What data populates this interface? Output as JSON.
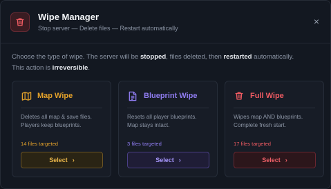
{
  "header": {
    "title": "Wipe Manager",
    "subtitle": "Stop server — Delete files — Restart automatically",
    "close_label": "×"
  },
  "intro": {
    "part1": "Choose the type of wipe. The server will be ",
    "stopped": "stopped",
    "part2": ", files deleted, then ",
    "restarted": "restarted",
    "part3": " automatically.",
    "part4": "This action is ",
    "irreversible": "irreversible",
    "part5": "."
  },
  "cards": [
    {
      "title": "Map Wipe",
      "icon": "map-icon",
      "desc_line1": "Deletes all map & save files.",
      "desc_line2": "Players keep blueprints.",
      "count": "14 files targeted",
      "select_label": "Select",
      "color": "#e3a12a"
    },
    {
      "title": "Blueprint Wipe",
      "icon": "document-icon",
      "desc_line1": "Resets all player blueprints.",
      "desc_line2": "Map stays intact.",
      "count": "3 files targeted",
      "select_label": "Select",
      "color": "#8f7cf0"
    },
    {
      "title": "Full Wipe",
      "icon": "trash-icon",
      "desc_line1": "Wipes map AND blueprints.",
      "desc_line2": "Complete fresh start.",
      "count": "17 files targeted",
      "select_label": "Select",
      "color": "#ef5b62"
    }
  ],
  "chevron": "›"
}
